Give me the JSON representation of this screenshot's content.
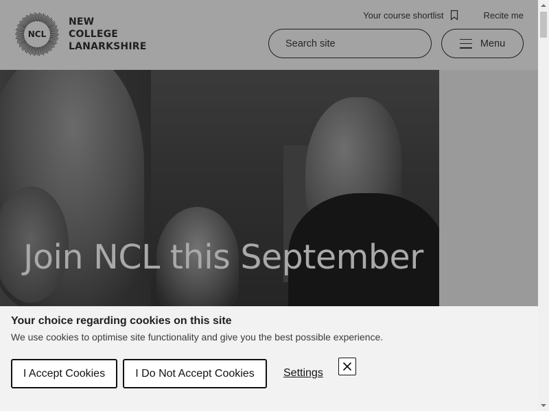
{
  "header": {
    "logo_mark_text": "NCL",
    "logo_lines": [
      "NEW",
      "COLLEGE",
      "LANARKSHIRE"
    ],
    "shortlist_label": "Your course shortlist",
    "recite_label": "Recite me",
    "search_placeholder": "Search site",
    "menu_label": "Menu"
  },
  "hero": {
    "title": "Join NCL this September"
  },
  "cookie_banner": {
    "title": "Your choice regarding cookies on this site",
    "text": "We use cookies to optimise site functionality and give you the best possible experience.",
    "accept_label": "I Accept Cookies",
    "decline_label": "I Do Not Accept Cookies",
    "settings_label": "Settings",
    "close_icon": "close-icon"
  },
  "icons": {
    "bookmark": "bookmark-icon",
    "menu": "hamburger-icon",
    "scroll_up": "chevron-up-icon",
    "scroll_down": "chevron-down-icon"
  }
}
